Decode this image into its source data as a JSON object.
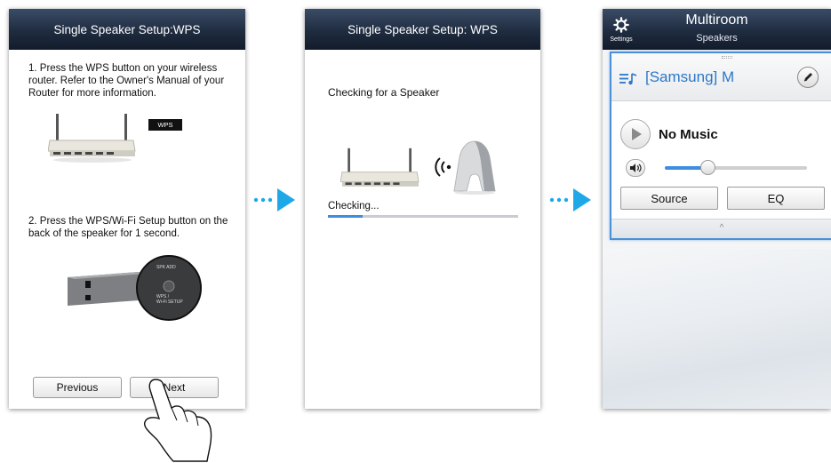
{
  "panel1": {
    "title": "Single Speaker Setup:WPS",
    "step1": "1. Press the WPS button on your wireless router. Refer to the Owner's Manual of your Router for more information.",
    "wps_tag": "WPS",
    "step2": "2. Press the WPS/Wi-Fi Setup button on the back of the speaker for 1 second.",
    "spk_add_label": "SPK ADD",
    "wps_wifi_label_1": "WPS /",
    "wps_wifi_label_2": "Wi-Fi SETUP",
    "previous_label": "Previous",
    "next_label": "Next"
  },
  "panel2": {
    "title": "Single Speaker Setup: WPS",
    "checking_heading": "Checking for a Speaker",
    "checking_status": "Checking...",
    "progress": 0.18
  },
  "panel3": {
    "settings_label": "Settings",
    "title": "Multiroom",
    "subtitle": "Speakers",
    "speaker_name": "[Samsung] M",
    "no_music": "No Music",
    "volume": 0.3,
    "source_label": "Source",
    "eq_label": "EQ",
    "collapse_glyph": "^"
  },
  "colors": {
    "accent_blue": "#2b78c9",
    "arrow_blue": "#1ea8e8",
    "title_bar": "#1f2c40"
  },
  "icons": [
    "router-icon",
    "speaker-icon",
    "wifi-signal-icon",
    "gear-icon",
    "playlist-icon",
    "pencil-icon",
    "play-icon",
    "volume-icon",
    "hand-pointer-icon",
    "arrow-right-icon"
  ]
}
